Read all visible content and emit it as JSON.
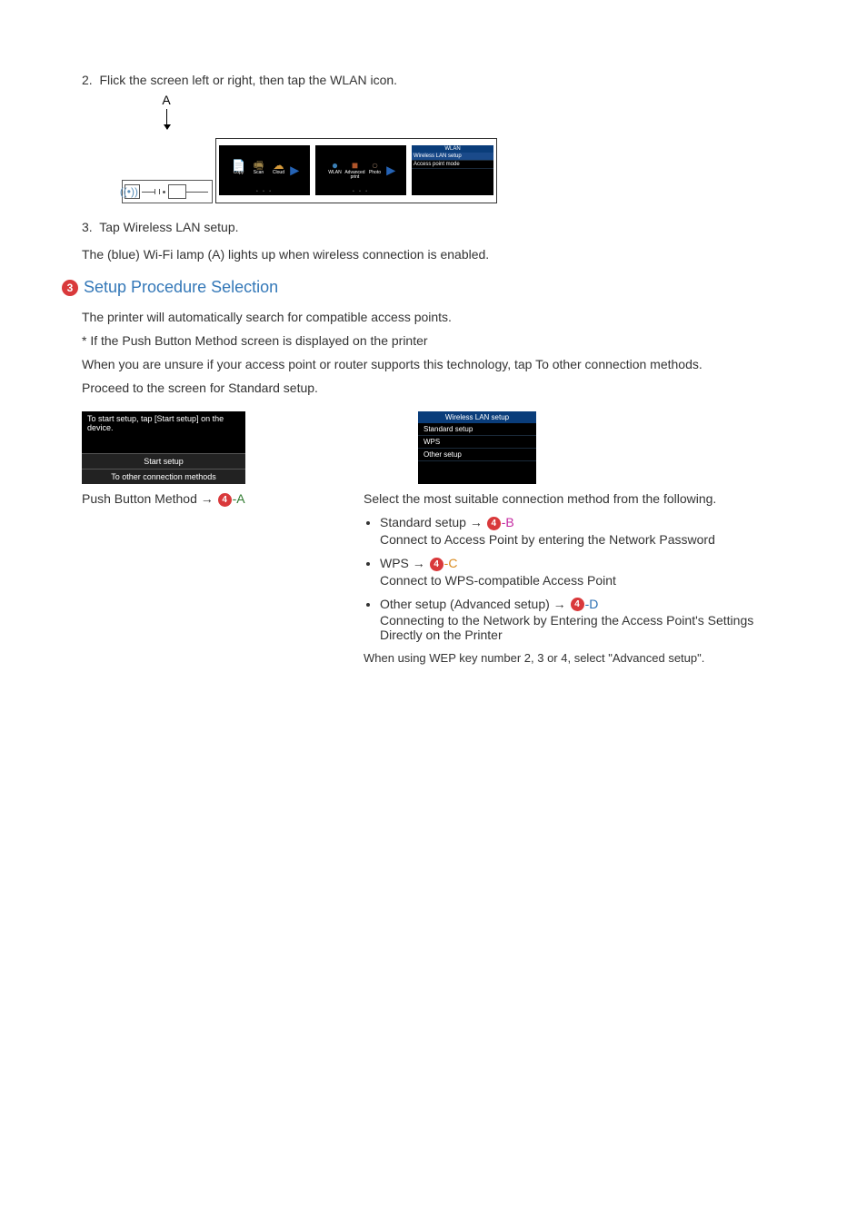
{
  "step2": {
    "num": "2.",
    "text": "Flick the screen left or right, then tap the WLAN icon."
  },
  "figure": {
    "labelA": "A",
    "wifi": "((•))",
    "screen1": {
      "icons": [
        {
          "glyph": "📄",
          "label": "Copy",
          "color": "#4aa3e0"
        },
        {
          "glyph": "🖷",
          "label": "Scan",
          "color": "#a0864a"
        },
        {
          "glyph": "☁",
          "label": "Cloud",
          "color": "#d59a3a"
        }
      ]
    },
    "screen2": {
      "icons": [
        {
          "glyph": "●",
          "label": "WLAN",
          "color": "#3b7fb5"
        },
        {
          "glyph": "■",
          "label": "Advanced print",
          "color": "#b0552a"
        },
        {
          "glyph": "○",
          "label": "Photo",
          "color": "#8a6f5a"
        }
      ]
    },
    "screen3": {
      "title": "WLAN",
      "items": [
        "Wireless LAN setup",
        "Access point mode"
      ]
    }
  },
  "step3": {
    "num": "3.",
    "text": "Tap Wireless LAN setup."
  },
  "wifiLampText": "The (blue) Wi-Fi lamp (A) lights up when wireless connection is enabled.",
  "sectionBadge": "3",
  "sectionTitle": "Setup Procedure Selection",
  "paras": {
    "p1": "The printer will automatically search for compatible access points.",
    "p2": "* If the Push Button Method screen is displayed on the printer",
    "p3": "When you are unsure if your access point or router supports this technology, tap To other connection methods.",
    "p4": "Proceed to the screen for Standard setup."
  },
  "leftScreen": {
    "line": "To start setup, tap [Start setup] on the device.",
    "btn1": "Start setup",
    "btn2": "To other connection methods"
  },
  "pushLabel": {
    "prefix": "Push Button Method → ",
    "badge": "4",
    "suffix": "-A"
  },
  "rightScreen": {
    "title": "Wireless LAN setup",
    "items": [
      "Standard setup",
      "WPS",
      "Other setup"
    ]
  },
  "rightIntro": "Select the most suitable connection method from the following.",
  "options": {
    "b": {
      "label": "Standard setup → ",
      "badge": "4",
      "suffix": "-B",
      "desc": "Connect to Access Point by entering the Network Password"
    },
    "c": {
      "label": "WPS → ",
      "badge": "4",
      "suffix": "-C",
      "desc": "Connect to WPS-compatible Access Point"
    },
    "d": {
      "label": "Other setup (Advanced setup) → ",
      "badge": "4",
      "suffix": "-D",
      "desc": "Connecting to the Network by Entering the Access Point's Settings Directly on the Printer"
    }
  },
  "footnote": "When using WEP key number 2, 3 or 4, select \"Advanced setup\"."
}
